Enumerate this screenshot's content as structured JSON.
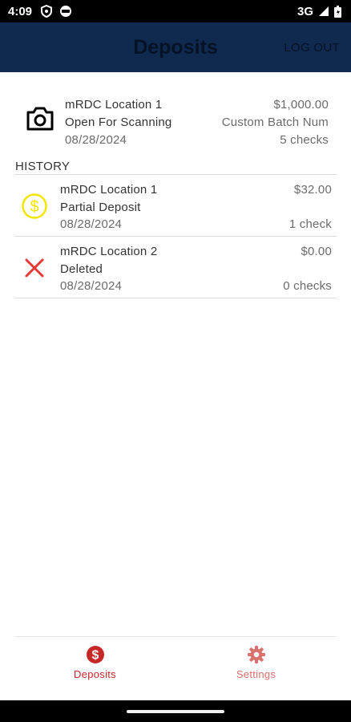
{
  "status_bar": {
    "time": "4:09",
    "network": "3G",
    "icons": [
      "shield-icon",
      "face-icon",
      "signal-icon",
      "battery-icon"
    ]
  },
  "app_bar": {
    "title": "Deposits",
    "logout_label": "LOG OUT"
  },
  "current_deposit": {
    "icon": "camera-icon",
    "location": "mRDC Location 1",
    "status": "Open For Scanning",
    "date": "08/28/2024",
    "amount": "$1,000.00",
    "batch": "Custom Batch Num",
    "checks": "5 checks"
  },
  "history": {
    "label": "HISTORY",
    "items": [
      {
        "icon": "dollar-circle-icon",
        "location": "mRDC Location 1",
        "status": "Partial Deposit",
        "date": "08/28/2024",
        "amount": "$32.00",
        "checks": "1 check"
      },
      {
        "icon": "close-icon",
        "location": "mRDC Location 2",
        "status": "Deleted",
        "date": "08/28/2024",
        "amount": "$0.00",
        "checks": "0 checks"
      }
    ]
  },
  "bottom_nav": {
    "items": [
      {
        "label": "Deposits",
        "icon": "dollar-circle-icon",
        "active": true
      },
      {
        "label": "Settings",
        "icon": "gear-icon",
        "active": false
      }
    ]
  },
  "colors": {
    "app_bar": "#0f2a4e",
    "active_nav": "#c62828",
    "inactive_nav": "#d9706e",
    "partial_icon": "#f2e600",
    "deleted_icon": "#e53935"
  }
}
